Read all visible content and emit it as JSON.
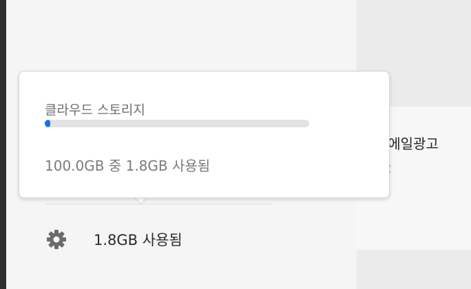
{
  "popover": {
    "title": "클라우드 스토리지",
    "usage_text": "100.0GB 중 1.8GB 사용됨",
    "progress_fraction": 0.018,
    "progress_color": "#1473e6"
  },
  "sidebar": {
    "storage_label": "1.8GB 사용됨",
    "storage_icon": "gear-icon"
  },
  "content": {
    "item_title_partial": "-에일광고",
    "item_sub_partial": "C"
  }
}
